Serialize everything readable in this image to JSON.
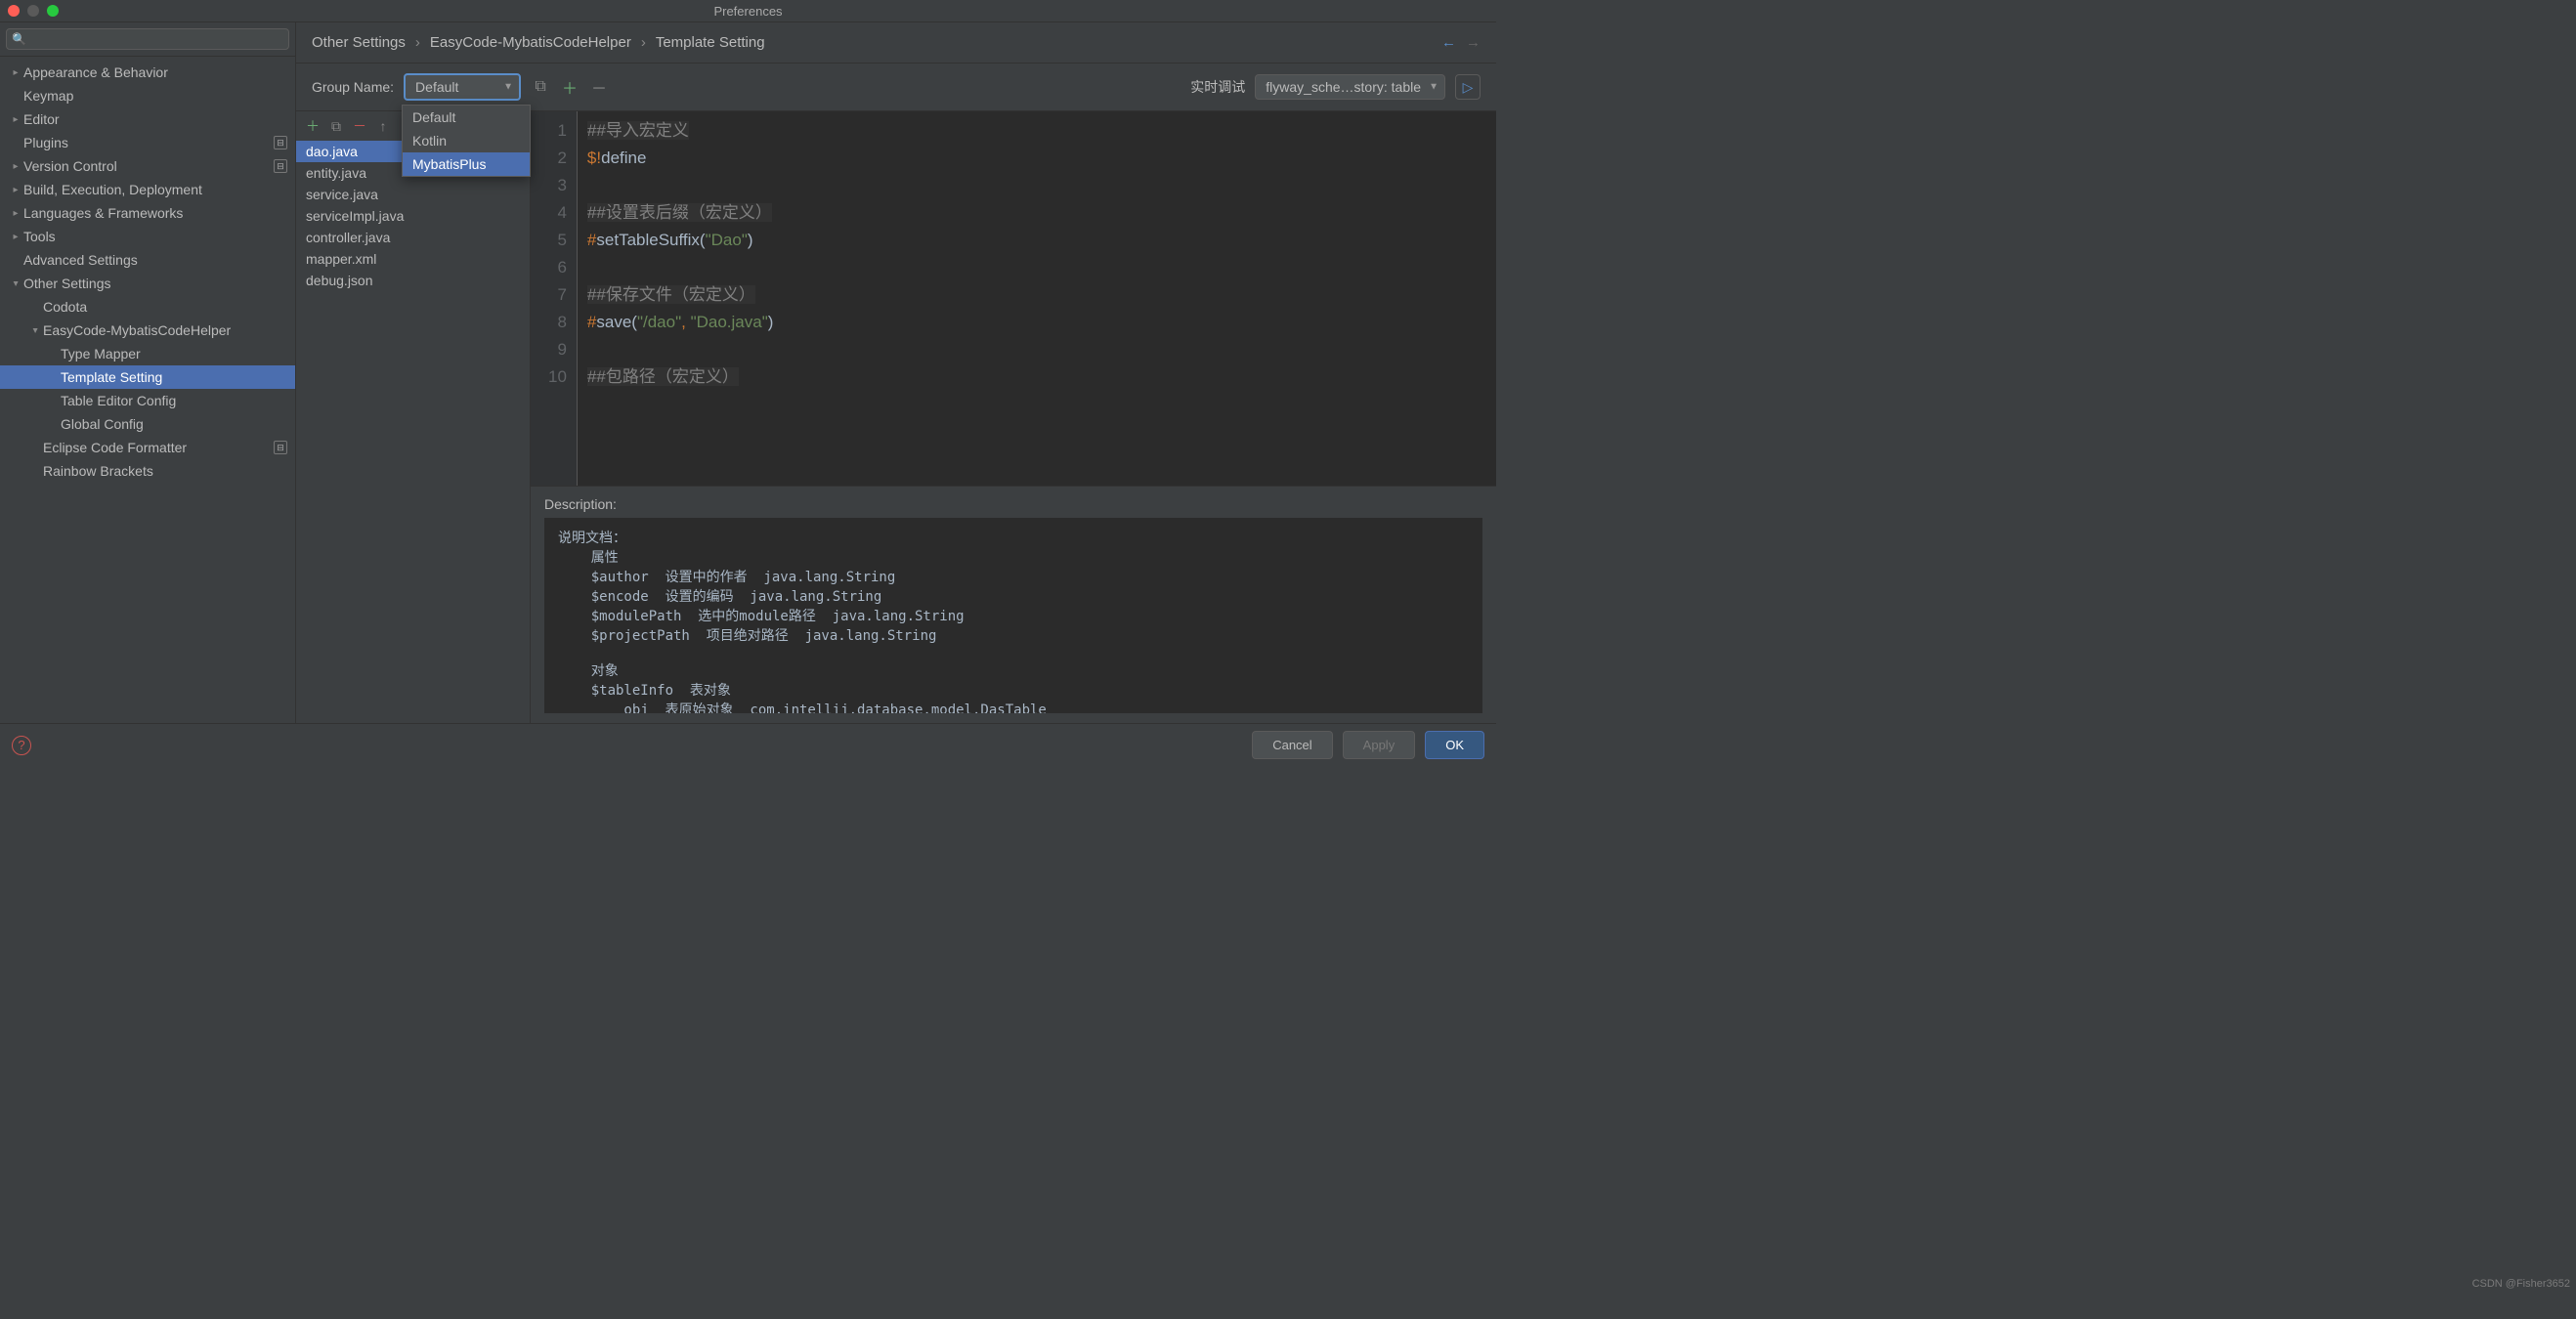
{
  "window": {
    "title": "Preferences"
  },
  "search": {
    "placeholder": ""
  },
  "sidebar": {
    "items": [
      {
        "label": "Appearance & Behavior",
        "expandable": true,
        "indent": 0
      },
      {
        "label": "Keymap",
        "expandable": false,
        "indent": 0
      },
      {
        "label": "Editor",
        "expandable": true,
        "indent": 0
      },
      {
        "label": "Plugins",
        "expandable": false,
        "indent": 0,
        "badge": true
      },
      {
        "label": "Version Control",
        "expandable": true,
        "indent": 0,
        "badge": true
      },
      {
        "label": "Build, Execution, Deployment",
        "expandable": true,
        "indent": 0
      },
      {
        "label": "Languages & Frameworks",
        "expandable": true,
        "indent": 0
      },
      {
        "label": "Tools",
        "expandable": true,
        "indent": 0
      },
      {
        "label": "Advanced Settings",
        "expandable": false,
        "indent": 0
      },
      {
        "label": "Other Settings",
        "expandable": true,
        "expanded": true,
        "indent": 0
      },
      {
        "label": "Codota",
        "expandable": false,
        "indent": 1
      },
      {
        "label": "EasyCode-MybatisCodeHelper",
        "expandable": true,
        "expanded": true,
        "indent": 1
      },
      {
        "label": "Type Mapper",
        "expandable": false,
        "indent": 2
      },
      {
        "label": "Template Setting",
        "expandable": false,
        "indent": 2,
        "selected": true
      },
      {
        "label": "Table Editor Config",
        "expandable": false,
        "indent": 2
      },
      {
        "label": "Global Config",
        "expandable": false,
        "indent": 2
      },
      {
        "label": "Eclipse Code Formatter",
        "expandable": false,
        "indent": 1,
        "badge": true
      },
      {
        "label": "Rainbow Brackets",
        "expandable": false,
        "indent": 1
      }
    ]
  },
  "breadcrumbs": [
    "Other Settings",
    "EasyCode-MybatisCodeHelper",
    "Template Setting"
  ],
  "toolbar": {
    "group_label": "Group Name:",
    "group_value": "Default",
    "dropdown_options": [
      "Default",
      "Kotlin",
      "MybatisPlus"
    ],
    "dropdown_selected": "MybatisPlus",
    "rt_label": "实时调试",
    "combo2_value": "flyway_sche…story: table"
  },
  "files": [
    "dao.java",
    "entity.java",
    "service.java",
    "serviceImpl.java",
    "controller.java",
    "mapper.xml",
    "debug.json"
  ],
  "files_selected": 0,
  "code": {
    "lines": [
      {
        "n": 1,
        "tokens": [
          {
            "c": "c-comment",
            "t": "##导入宏定义"
          }
        ]
      },
      {
        "n": 2,
        "tokens": [
          {
            "c": "c-bang",
            "t": "$!"
          },
          {
            "c": "c-plain",
            "t": "define"
          }
        ]
      },
      {
        "n": 3,
        "tokens": []
      },
      {
        "n": 4,
        "tokens": [
          {
            "c": "c-comment",
            "t": "##设置表后缀（宏定义）"
          }
        ]
      },
      {
        "n": 5,
        "tokens": [
          {
            "c": "c-key",
            "t": "#"
          },
          {
            "c": "c-plain",
            "t": "setTableSuffix("
          },
          {
            "c": "c-str",
            "t": "\"Dao\""
          },
          {
            "c": "c-plain",
            "t": ")"
          }
        ]
      },
      {
        "n": 6,
        "tokens": []
      },
      {
        "n": 7,
        "tokens": [
          {
            "c": "c-comment",
            "t": "##保存文件（宏定义）"
          }
        ]
      },
      {
        "n": 8,
        "tokens": [
          {
            "c": "c-key",
            "t": "#"
          },
          {
            "c": "c-plain",
            "t": "save("
          },
          {
            "c": "c-str",
            "t": "\"/dao\""
          },
          {
            "c": "c-key",
            "t": ", "
          },
          {
            "c": "c-str",
            "t": "\"Dao.java\""
          },
          {
            "c": "c-plain",
            "t": ")"
          }
        ]
      },
      {
        "n": 9,
        "tokens": []
      },
      {
        "n": 10,
        "tokens": [
          {
            "c": "c-comment",
            "t": "##包路径（宏定义）"
          }
        ]
      }
    ]
  },
  "description": {
    "label": "Description:",
    "text": "说明文档：\n    属性\n    $author  设置中的作者  java.lang.String\n    $encode  设置的编码  java.lang.String\n    $modulePath  选中的module路径  java.lang.String\n    $projectPath  项目绝对路径  java.lang.String\n\n    对象\n    $tableInfo  表对象\n        obj  表原始对象  com.intellij.database.model.DasTable"
  },
  "footer": {
    "cancel": "Cancel",
    "apply": "Apply",
    "ok": "OK"
  },
  "watermark": "CSDN @Fisher3652"
}
